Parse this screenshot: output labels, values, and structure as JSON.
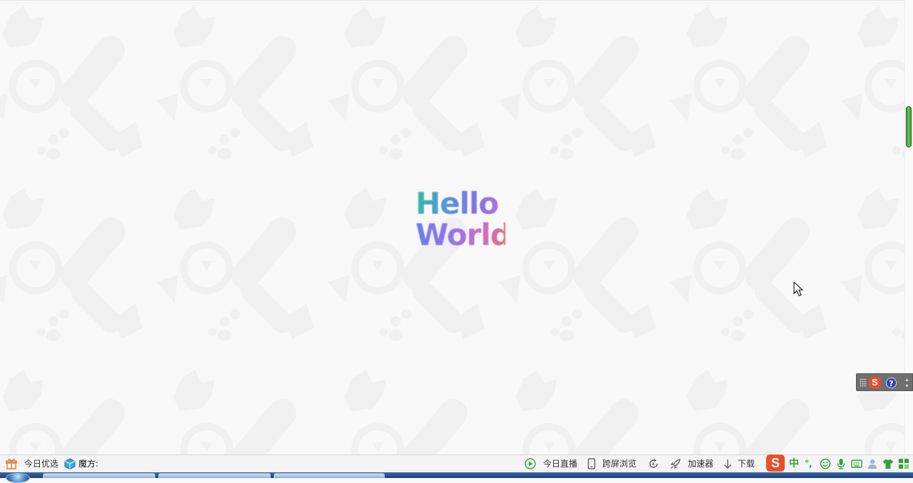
{
  "page": {
    "greeting_line1": "Hello",
    "greeting_line2": "World"
  },
  "status_bar": {
    "left": [
      {
        "icon": "gift-icon",
        "label": "今日优选"
      },
      {
        "icon": "cube-icon",
        "label": "魔方:"
      }
    ],
    "right": [
      {
        "icon": "play-circle-icon",
        "label": "今日直播"
      },
      {
        "icon": "phone-icon",
        "label": "跨屏浏览"
      },
      {
        "icon": "refresh-icon",
        "label": ""
      },
      {
        "icon": "rocket-icon",
        "label": "加速器"
      },
      {
        "icon": "download-arrow-icon",
        "label": "下载"
      }
    ]
  },
  "ime_toolbar": {
    "logo": "S",
    "help": "?"
  },
  "tray": {
    "ime_logo": "S",
    "mode": "中",
    "punct": "°,",
    "icons": [
      "smiley-icon",
      "microphone-icon",
      "keyboard-icon",
      "user-icon",
      "shirt-icon",
      "grid-icon"
    ]
  },
  "colors": {
    "scroll_thumb": "#5bbf4c",
    "ime_accent": "#e8502a",
    "taskbar": "#2a5496"
  }
}
